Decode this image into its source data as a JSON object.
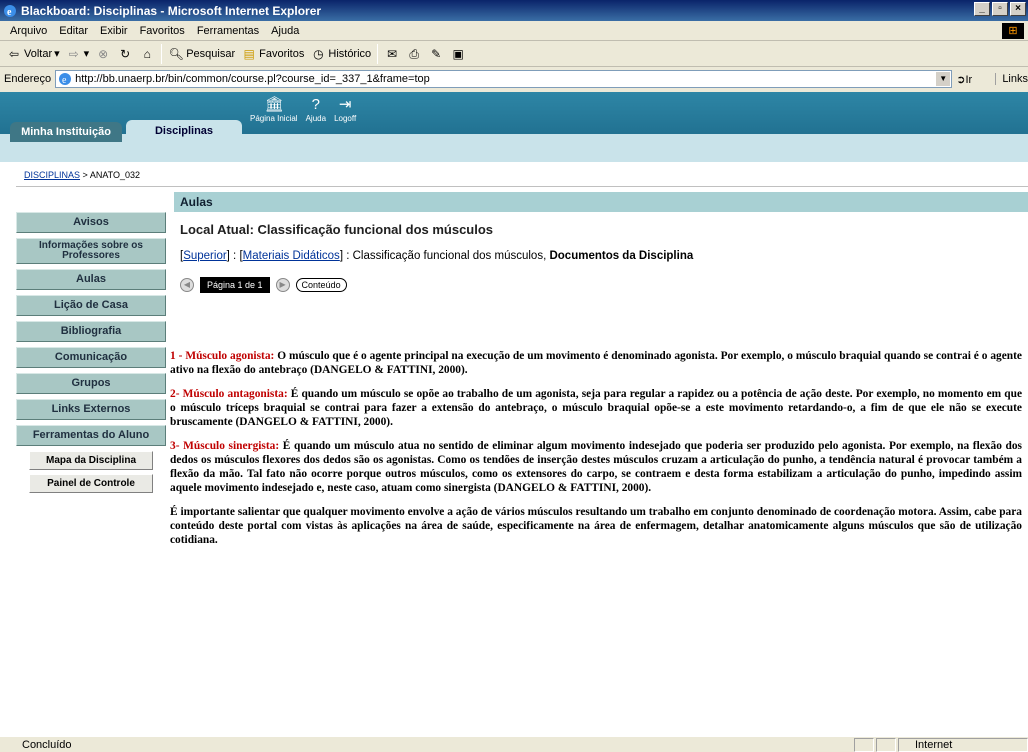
{
  "window": {
    "title": "Blackboard: Disciplinas - Microsoft Internet Explorer"
  },
  "menu": [
    "Arquivo",
    "Editar",
    "Exibir",
    "Favoritos",
    "Ferramentas",
    "Ajuda"
  ],
  "toolbar": {
    "back": "Voltar",
    "search": "Pesquisar",
    "favorites": "Favoritos",
    "history": "Histórico"
  },
  "address": {
    "label": "Endereço",
    "url": "http://bb.unaerp.br/bin/common/course.pl?course_id=_337_1&frame=top",
    "go": "Ir",
    "links": "Links"
  },
  "bb": {
    "tab_inst": "Minha Instituição",
    "tab_disc": "Disciplinas",
    "icons": [
      "Página Inicial",
      "Ajuda",
      "Logoff"
    ]
  },
  "breadcrumb": {
    "link": "DISCIPLINAS",
    "sep": ">",
    "current": "ANATO_032"
  },
  "sidebar": {
    "items": [
      "Avisos",
      "Informações sobre os Professores",
      "Aulas",
      "Lição de Casa",
      "Bibliografia",
      "Comunicação",
      "Grupos",
      "Links Externos",
      "Ferramentas do Aluno"
    ],
    "sub": [
      "Mapa da Disciplina",
      "Painel de Controle"
    ]
  },
  "main": {
    "section": "Aulas",
    "local": "Local Atual: Classificação funcional dos músculos",
    "path": {
      "open": "[",
      "superior": "Superior",
      "mid": "] : [",
      "materiais": "Materiais Didáticos",
      "rest": "] : Classificação funcional dos músculos, ",
      "docs": "Documentos da Disciplina"
    },
    "pager": {
      "label": "Página 1 de 1",
      "content": "Conteúdo"
    }
  },
  "article": {
    "p1_title": "1 - Músculo agonista:",
    "p1_text": " O músculo que é o agente principal na execução de um movimento é denominado agonista. Por exemplo, o músculo braquial quando se contrai é o agente ativo na flexão do antebraço (DANGELO & FATTINI, 2000).",
    "p2_title": "2- Músculo antagonista:",
    "p2_text": " É quando um músculo se opõe ao trabalho de um agonista, seja para regular a rapidez ou a potência de ação deste. Por exemplo, no momento em que o músculo tríceps braquial se contrai para fazer a extensão do antebraço, o músculo braquial opõe-se a este movimento retardando-o, a fim de que ele não se execute bruscamente (DANGELO & FATTINI, 2000).",
    "p3_title": "3- Músculo sinergista:",
    "p3_text": " É quando um músculo atua no sentido de eliminar algum movimento indesejado que poderia ser produzido pelo agonista. Por exemplo, na flexão dos dedos os músculos flexores dos dedos são os agonistas. Como os tendões de inserção destes músculos cruzam a articulação do punho, a tendência natural é provocar também a flexão da mão. Tal fato não ocorre porque outros músculos, como os extensores do carpo, se contraem e desta forma estabilizam a articulação do punho, impedindo assim aquele movimento indesejado e, neste caso, atuam como sinergista (DANGELO & FATTINI, 2000).",
    "p4_text": "É importante salientar que qualquer movimento envolve a ação de vários músculos resultando um trabalho em conjunto denominado de coordenação motora. Assim, cabe para conteúdo deste portal com vistas às aplicações na área de saúde, especificamente na área de enfermagem, detalhar anatomicamente alguns músculos que são de utilização cotidiana."
  },
  "status": {
    "text": "Concluído",
    "zone": "Internet"
  }
}
